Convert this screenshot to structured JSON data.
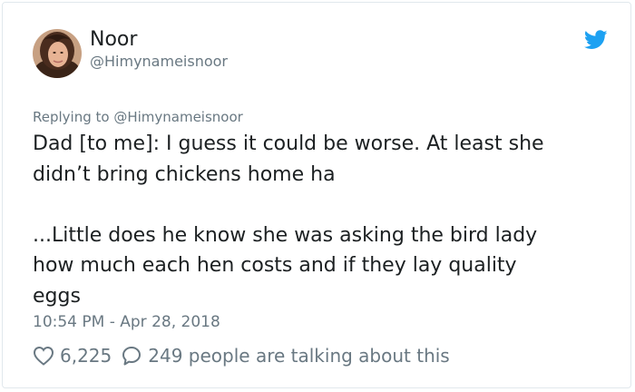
{
  "author": {
    "display_name": "Noor",
    "handle": "@Himynameisnoor",
    "avatar_icon": "profile-photo"
  },
  "reply_context": {
    "text": "Replying to @Himynameisnoor"
  },
  "tweet": {
    "paragraphs": [
      [
        "Dad [to me]: I guess it could be worse. At least she",
        "didn’t bring chickens home ha"
      ],
      [
        "...Little does he know she was asking the bird lady",
        "how much each hen costs and if they lay quality",
        "eggs"
      ]
    ],
    "timestamp": "10:54 PM - Apr 28, 2018"
  },
  "engagement": {
    "likes": "6,225",
    "talking_text": "249 people are talking about this"
  },
  "colors": {
    "twitter_blue": "#1da1f2",
    "text_primary": "#1c2022",
    "text_secondary": "#697882",
    "border": "#e1e8ed"
  },
  "icons": {
    "brand": "twitter-bird-icon",
    "like": "heart-icon",
    "reply": "speech-bubble-icon"
  }
}
